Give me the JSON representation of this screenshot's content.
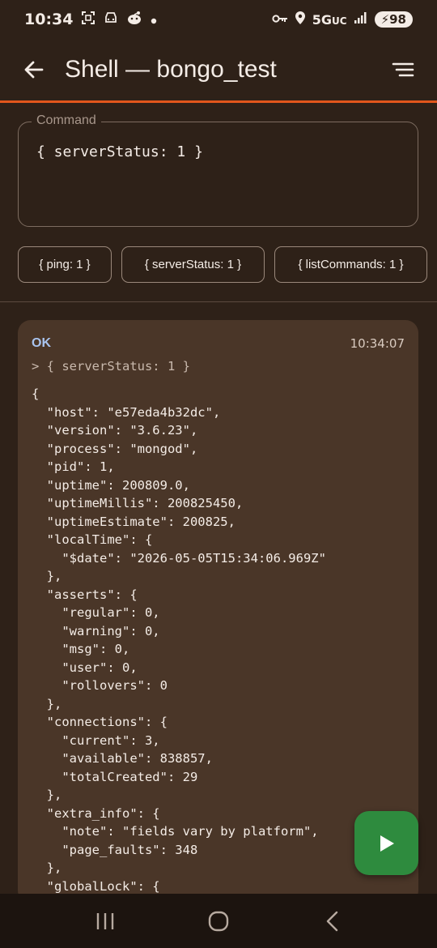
{
  "status_bar": {
    "time": "10:34",
    "network": "5G",
    "network_suffix": "UC",
    "battery": "98",
    "icons": [
      "screenshot-icon",
      "car-icon",
      "reddit-icon",
      "dot-icon",
      "key-icon",
      "location-icon",
      "signal-icon",
      "battery-charging-icon"
    ]
  },
  "app_bar": {
    "title": "Shell — bongo_test",
    "back_icon": "arrow-left-icon",
    "menu_icon": "sort-lines-icon"
  },
  "command": {
    "label": "Command",
    "value": "{ serverStatus: 1 }"
  },
  "quick_commands": [
    "{ ping: 1 }",
    "{ serverStatus: 1 }",
    "{ listCommands: 1 }"
  ],
  "result": {
    "status": "OK",
    "timestamp": "10:34:07",
    "echo": "> { serverStatus: 1 }",
    "output_lines": [
      "{",
      "  \"host\": \"e57eda4b32dc\",",
      "  \"version\": \"3.6.23\",",
      "  \"process\": \"mongod\",",
      "  \"pid\": 1,",
      "  \"uptime\": 200809.0,",
      "  \"uptimeMillis\": 200825450,",
      "  \"uptimeEstimate\": 200825,",
      "  \"localTime\": {",
      "    \"$date\": \"2026-05-05T15:34:06.969Z\"",
      "  },",
      "  \"asserts\": {",
      "    \"regular\": 0,",
      "    \"warning\": 0,",
      "    \"msg\": 0,",
      "    \"user\": 0,",
      "    \"rollovers\": 0",
      "  },",
      "  \"connections\": {",
      "    \"current\": 3,",
      "    \"available\": 838857,",
      "    \"totalCreated\": 29",
      "  },",
      "  \"extra_info\": {",
      "    \"note\": \"fields vary by platform\",",
      "    \"page_faults\": 348",
      "  },",
      "  \"globalLock\": {"
    ]
  },
  "fab": {
    "icon": "play-icon"
  },
  "colors": {
    "background": "#2e2118",
    "accent": "#e2561c",
    "card": "#4a3628",
    "ok": "#a9c4ef",
    "fab": "#2e8b3e"
  }
}
